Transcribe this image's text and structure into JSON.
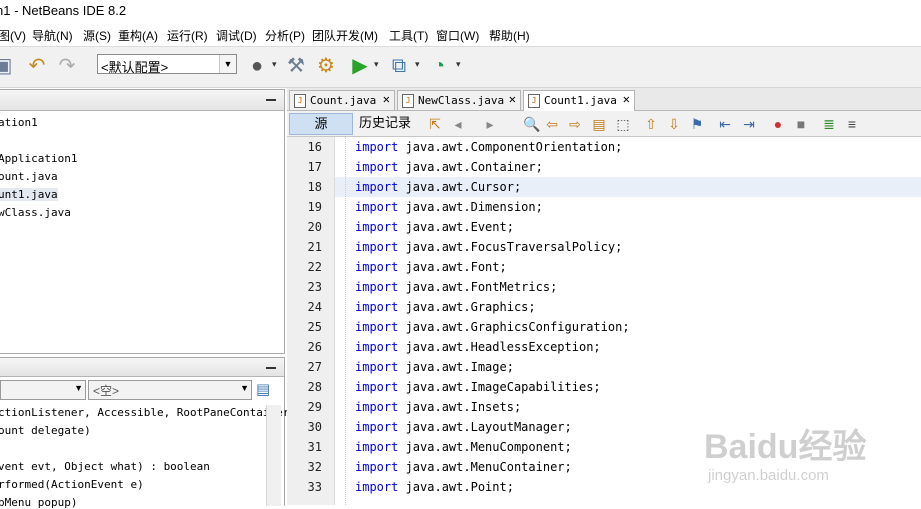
{
  "window": {
    "title": "n1 - NetBeans IDE 8.2"
  },
  "menu": [
    "图(V)",
    "导航(N)",
    "源(S)",
    "重构(A)",
    "运行(R)",
    "调试(D)",
    "分析(P)",
    "团队开发(M)",
    "工具(T)",
    "窗口(W)",
    "帮助(H)"
  ],
  "toolbar": {
    "config_value": "<默认配置>"
  },
  "project_tree": [
    "ation1",
    "Application1",
    "ount.java",
    "unt1.java",
    "wClass.java"
  ],
  "navigator": {
    "combo_value": "",
    "combo2_value": "<空>",
    "lines": [
      "ctionListener, Accessible, RootPaneContainer,",
      "ount delegate)",
      "",
      "vent evt, Object what) : boolean",
      "rformed(ActionEvent e)",
      "pMenu popup)"
    ]
  },
  "editor": {
    "tabs": [
      {
        "label": "Count.java",
        "active": false
      },
      {
        "label": "NewClass.java",
        "active": false
      },
      {
        "label": "Count1.java",
        "active": true
      }
    ],
    "view_tabs": {
      "source": "源",
      "history": "历史记录"
    },
    "highlight_line": 18,
    "lines": [
      {
        "n": "16",
        "kw": "import",
        "rest": " java.awt.ComponentOrientation;"
      },
      {
        "n": "17",
        "kw": "import",
        "rest": " java.awt.Container;"
      },
      {
        "n": "18",
        "kw": "import",
        "rest": " java.awt.Cursor;"
      },
      {
        "n": "19",
        "kw": "import",
        "rest": " java.awt.Dimension;"
      },
      {
        "n": "20",
        "kw": "import",
        "rest": " java.awt.Event;"
      },
      {
        "n": "21",
        "kw": "import",
        "rest": " java.awt.FocusTraversalPolicy;"
      },
      {
        "n": "22",
        "kw": "import",
        "rest": " java.awt.Font;"
      },
      {
        "n": "23",
        "kw": "import",
        "rest": " java.awt.FontMetrics;"
      },
      {
        "n": "24",
        "kw": "import",
        "rest": " java.awt.Graphics;"
      },
      {
        "n": "25",
        "kw": "import",
        "rest": " java.awt.GraphicsConfiguration;"
      },
      {
        "n": "26",
        "kw": "import",
        "rest": " java.awt.HeadlessException;"
      },
      {
        "n": "27",
        "kw": "import",
        "rest": " java.awt.Image;"
      },
      {
        "n": "28",
        "kw": "import",
        "rest": " java.awt.ImageCapabilities;"
      },
      {
        "n": "29",
        "kw": "import",
        "rest": " java.awt.Insets;"
      },
      {
        "n": "30",
        "kw": "import",
        "rest": " java.awt.LayoutManager;"
      },
      {
        "n": "31",
        "kw": "import",
        "rest": " java.awt.MenuComponent;"
      },
      {
        "n": "32",
        "kw": "import",
        "rest": " java.awt.MenuContainer;"
      },
      {
        "n": "33",
        "kw": "import",
        "rest": " java.awt.Point;"
      }
    ]
  },
  "watermark": {
    "text": "Baidu经验",
    "sub": "jingyan.baidu.com"
  }
}
